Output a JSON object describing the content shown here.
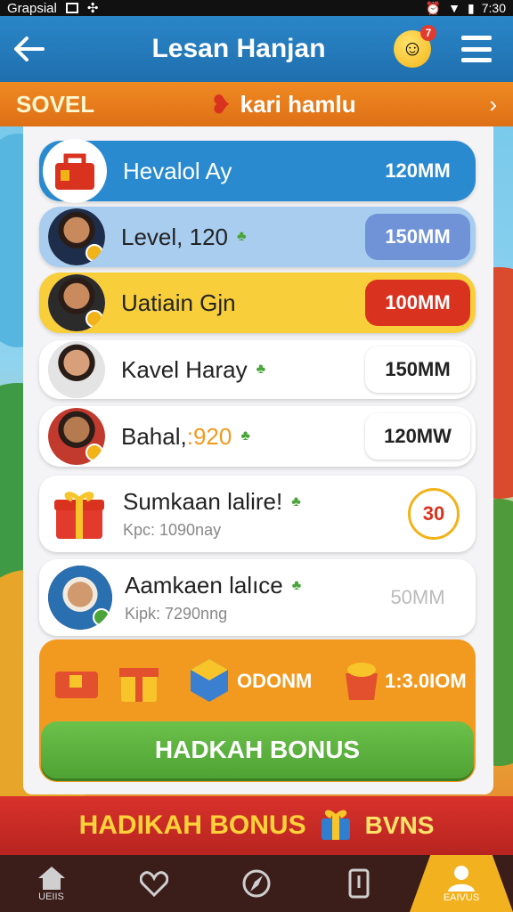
{
  "status_bar": {
    "left_text": "Grapsial",
    "right_text": "7:30"
  },
  "header": {
    "title": "Lesan Hanjan",
    "notification_count": "7"
  },
  "subheader": {
    "left": "SOVEL",
    "middle": "kari hamlu",
    "chevron": "›"
  },
  "list": [
    {
      "name": "Hevalol Ay",
      "value": "120MM",
      "bg": "#2a8ad0",
      "val_bg": "transparent",
      "val_color": "#ffffff",
      "name_color": "#ffffff",
      "icon": "lunchbox-icon"
    },
    {
      "name": "Level, 120",
      "value": "150MM",
      "bg": "#a9cdef",
      "val_bg": "#6f93d6",
      "val_color": "#ffffff",
      "name_color": "#222222",
      "icon": "avatar"
    },
    {
      "name": "Uatiain Gjn",
      "value": "100MM",
      "bg": "#f8cf3a",
      "val_bg": "#d9321f",
      "val_color": "#ffffff",
      "name_color": "#222222",
      "icon": "avatar"
    },
    {
      "name": "Kavel Haray",
      "value": "150MM",
      "bg": "#ffffff",
      "val_bg": "#ffffff",
      "val_color": "#222222",
      "name_color": "#222222",
      "icon": "avatar"
    },
    {
      "name": "Bahal,",
      "name_accent": ":920",
      "value": "120MW",
      "bg": "#ffffff",
      "val_bg": "#ffffff",
      "val_color": "#222222",
      "name_color": "#222222",
      "icon": "avatar"
    }
  ],
  "featured": [
    {
      "name": "Sumkaan lalire!",
      "sub": "Kpc: 1090nay",
      "badge": "30",
      "icon": "gift-icon"
    },
    {
      "name": "Aamkaen lalıce",
      "sub": "Kipk: 7290nng",
      "value": "50MM",
      "icon": "avatar"
    }
  ],
  "bonus": {
    "amount_1": "ODONM",
    "amount_2": "1:3.0IOM",
    "button": "HADKAH BONUS"
  },
  "banner": {
    "text": "HADIKAH BONUS",
    "text_2": "BVNS"
  },
  "nav": [
    {
      "label": "UEIIS",
      "icon": "home-icon"
    },
    {
      "label": "",
      "icon": "heart-icon"
    },
    {
      "label": "",
      "icon": "compass-icon"
    },
    {
      "label": "",
      "icon": "phone-icon"
    },
    {
      "label": "EAIVUS",
      "icon": "profile-icon"
    }
  ],
  "colors": {
    "header": "#2a86c8",
    "subheader": "#ef8a22",
    "bonus": "#f19a1f",
    "button": "#5cb13f",
    "banner": "#d8322b",
    "nav": "#3b1d1a"
  }
}
